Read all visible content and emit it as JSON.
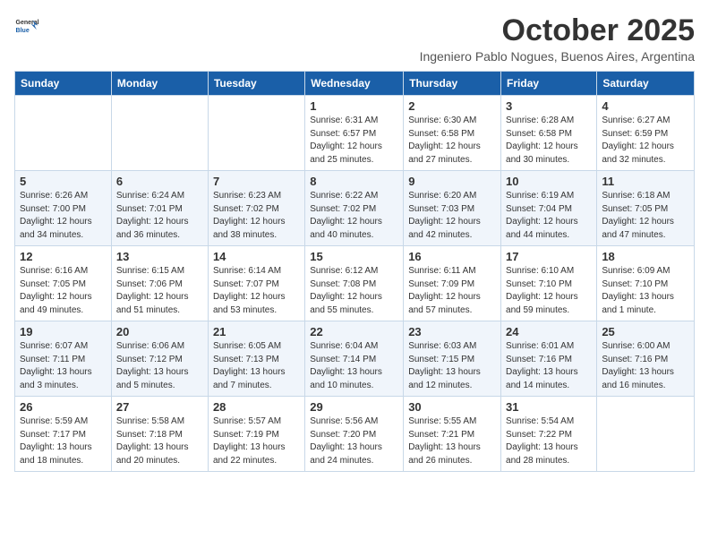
{
  "header": {
    "logo_line1": "General",
    "logo_line2": "Blue",
    "month": "October 2025",
    "location": "Ingeniero Pablo Nogues, Buenos Aires, Argentina"
  },
  "columns": [
    "Sunday",
    "Monday",
    "Tuesday",
    "Wednesday",
    "Thursday",
    "Friday",
    "Saturday"
  ],
  "weeks": [
    [
      {
        "day": "",
        "text": ""
      },
      {
        "day": "",
        "text": ""
      },
      {
        "day": "",
        "text": ""
      },
      {
        "day": "1",
        "text": "Sunrise: 6:31 AM\nSunset: 6:57 PM\nDaylight: 12 hours and 25 minutes."
      },
      {
        "day": "2",
        "text": "Sunrise: 6:30 AM\nSunset: 6:58 PM\nDaylight: 12 hours and 27 minutes."
      },
      {
        "day": "3",
        "text": "Sunrise: 6:28 AM\nSunset: 6:58 PM\nDaylight: 12 hours and 30 minutes."
      },
      {
        "day": "4",
        "text": "Sunrise: 6:27 AM\nSunset: 6:59 PM\nDaylight: 12 hours and 32 minutes."
      }
    ],
    [
      {
        "day": "5",
        "text": "Sunrise: 6:26 AM\nSunset: 7:00 PM\nDaylight: 12 hours and 34 minutes."
      },
      {
        "day": "6",
        "text": "Sunrise: 6:24 AM\nSunset: 7:01 PM\nDaylight: 12 hours and 36 minutes."
      },
      {
        "day": "7",
        "text": "Sunrise: 6:23 AM\nSunset: 7:02 PM\nDaylight: 12 hours and 38 minutes."
      },
      {
        "day": "8",
        "text": "Sunrise: 6:22 AM\nSunset: 7:02 PM\nDaylight: 12 hours and 40 minutes."
      },
      {
        "day": "9",
        "text": "Sunrise: 6:20 AM\nSunset: 7:03 PM\nDaylight: 12 hours and 42 minutes."
      },
      {
        "day": "10",
        "text": "Sunrise: 6:19 AM\nSunset: 7:04 PM\nDaylight: 12 hours and 44 minutes."
      },
      {
        "day": "11",
        "text": "Sunrise: 6:18 AM\nSunset: 7:05 PM\nDaylight: 12 hours and 47 minutes."
      }
    ],
    [
      {
        "day": "12",
        "text": "Sunrise: 6:16 AM\nSunset: 7:05 PM\nDaylight: 12 hours and 49 minutes."
      },
      {
        "day": "13",
        "text": "Sunrise: 6:15 AM\nSunset: 7:06 PM\nDaylight: 12 hours and 51 minutes."
      },
      {
        "day": "14",
        "text": "Sunrise: 6:14 AM\nSunset: 7:07 PM\nDaylight: 12 hours and 53 minutes."
      },
      {
        "day": "15",
        "text": "Sunrise: 6:12 AM\nSunset: 7:08 PM\nDaylight: 12 hours and 55 minutes."
      },
      {
        "day": "16",
        "text": "Sunrise: 6:11 AM\nSunset: 7:09 PM\nDaylight: 12 hours and 57 minutes."
      },
      {
        "day": "17",
        "text": "Sunrise: 6:10 AM\nSunset: 7:10 PM\nDaylight: 12 hours and 59 minutes."
      },
      {
        "day": "18",
        "text": "Sunrise: 6:09 AM\nSunset: 7:10 PM\nDaylight: 13 hours and 1 minute."
      }
    ],
    [
      {
        "day": "19",
        "text": "Sunrise: 6:07 AM\nSunset: 7:11 PM\nDaylight: 13 hours and 3 minutes."
      },
      {
        "day": "20",
        "text": "Sunrise: 6:06 AM\nSunset: 7:12 PM\nDaylight: 13 hours and 5 minutes."
      },
      {
        "day": "21",
        "text": "Sunrise: 6:05 AM\nSunset: 7:13 PM\nDaylight: 13 hours and 7 minutes."
      },
      {
        "day": "22",
        "text": "Sunrise: 6:04 AM\nSunset: 7:14 PM\nDaylight: 13 hours and 10 minutes."
      },
      {
        "day": "23",
        "text": "Sunrise: 6:03 AM\nSunset: 7:15 PM\nDaylight: 13 hours and 12 minutes."
      },
      {
        "day": "24",
        "text": "Sunrise: 6:01 AM\nSunset: 7:16 PM\nDaylight: 13 hours and 14 minutes."
      },
      {
        "day": "25",
        "text": "Sunrise: 6:00 AM\nSunset: 7:16 PM\nDaylight: 13 hours and 16 minutes."
      }
    ],
    [
      {
        "day": "26",
        "text": "Sunrise: 5:59 AM\nSunset: 7:17 PM\nDaylight: 13 hours and 18 minutes."
      },
      {
        "day": "27",
        "text": "Sunrise: 5:58 AM\nSunset: 7:18 PM\nDaylight: 13 hours and 20 minutes."
      },
      {
        "day": "28",
        "text": "Sunrise: 5:57 AM\nSunset: 7:19 PM\nDaylight: 13 hours and 22 minutes."
      },
      {
        "day": "29",
        "text": "Sunrise: 5:56 AM\nSunset: 7:20 PM\nDaylight: 13 hours and 24 minutes."
      },
      {
        "day": "30",
        "text": "Sunrise: 5:55 AM\nSunset: 7:21 PM\nDaylight: 13 hours and 26 minutes."
      },
      {
        "day": "31",
        "text": "Sunrise: 5:54 AM\nSunset: 7:22 PM\nDaylight: 13 hours and 28 minutes."
      },
      {
        "day": "",
        "text": ""
      }
    ]
  ]
}
